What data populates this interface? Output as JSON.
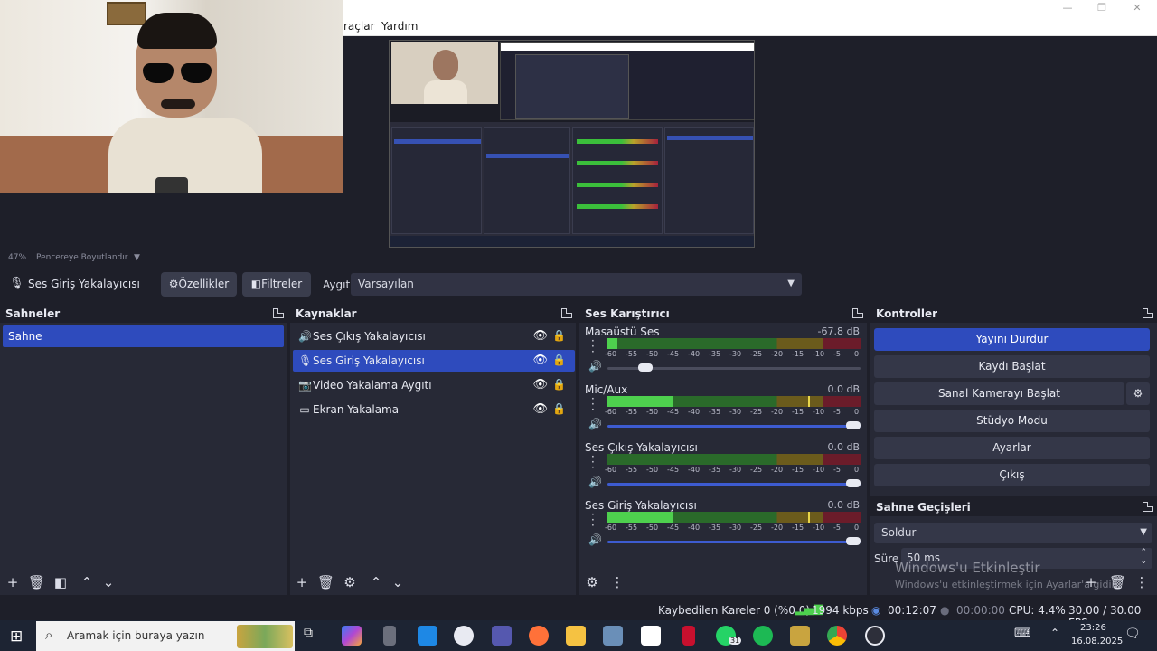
{
  "menu": {
    "tools_partial": "raçlar",
    "help": "Yardım"
  },
  "zoom": {
    "percent": "47%",
    "mode": "Pencereye Boyutlandır"
  },
  "source_toolbar": {
    "source_name": "Ses Giriş Yakalayıcısı",
    "properties": "Özellikler",
    "filters": "Filtreler",
    "device_label": "Aygıt",
    "device_value": "Varsayılan"
  },
  "scenes": {
    "title": "Sahneler",
    "items": [
      "Sahne"
    ]
  },
  "sources": {
    "title": "Kaynaklar",
    "items": [
      {
        "label": "Ses Çıkış Yakalayıcısı",
        "icon": "speaker-icon"
      },
      {
        "label": "Ses Giriş Yakalayıcısı",
        "icon": "mic-icon"
      },
      {
        "label": "Video Yakalama Aygıtı",
        "icon": "camera-icon"
      },
      {
        "label": "Ekran Yakalama",
        "icon": "monitor-icon"
      }
    ]
  },
  "mixer": {
    "title": "Ses Karıştırıcı",
    "ticks": [
      "-60",
      "-55",
      "-50",
      "-45",
      "-40",
      "-35",
      "-30",
      "-25",
      "-20",
      "-15",
      "-10",
      "-5",
      "0"
    ],
    "channels": [
      {
        "name": "Masaüstü Ses",
        "db": "-67.8 dB",
        "level": 0.04,
        "volume": 0.13
      },
      {
        "name": "Mic/Aux",
        "db": "0.0 dB",
        "level": 0.26,
        "volume": 1.0
      },
      {
        "name": "Ses Çıkış Yakalayıcısı",
        "db": "0.0 dB",
        "level": 0.0,
        "volume": 1.0
      },
      {
        "name": "Ses Giriş Yakalayıcısı",
        "db": "0.0 dB",
        "level": 0.26,
        "volume": 1.0
      }
    ]
  },
  "controls": {
    "title": "Kontroller",
    "stop_stream": "Yayını Durdur",
    "start_record": "Kaydı Başlat",
    "start_vcam": "Sanal Kamerayı Başlat",
    "studio_mode": "Stüdyo Modu",
    "settings": "Ayarlar",
    "exit": "Çıkış"
  },
  "transitions": {
    "title": "Sahne Geçişleri",
    "type": "Soldur",
    "duration_label": "Süre",
    "duration_value": "50 ms"
  },
  "watermark": {
    "line1": "Windows'u Etkinleştir",
    "line2": "Windows'u etkinleştirmek için Ayarlar'a gidin."
  },
  "status": {
    "dropped": "Kaybedilen Kareler 0 (%0.0)",
    "bitrate": "1994 kbps",
    "stream_time": "00:12:07",
    "record_time": "00:00:00",
    "cpu": "CPU: 4.4%",
    "fps": "30.00 / 30.00 FPS"
  },
  "taskbar": {
    "search_placeholder": "Aramak için buraya yazın",
    "whatsapp_badge": "31",
    "time": "23:26",
    "date": "16.08.2025"
  },
  "colors": {
    "accent": "#2e4bbd",
    "panel": "#272936",
    "bg": "#1e1f29"
  }
}
